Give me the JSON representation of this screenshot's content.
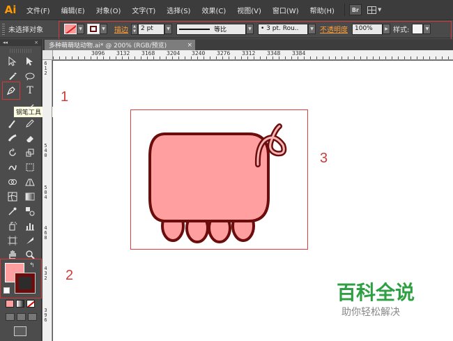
{
  "app": {
    "logo": "Ai"
  },
  "menu": [
    "文件(F)",
    "编辑(E)",
    "对象(O)",
    "文字(T)",
    "选择(S)",
    "效果(C)",
    "视图(V)",
    "窗口(W)",
    "帮助(H)"
  ],
  "menu_extra": {
    "bridge": "Br"
  },
  "control": {
    "selection_label": "未选择对象",
    "stroke_label": "描边",
    "stroke_weight": "2 pt",
    "profile_label": "等比",
    "brush": "• 3 pt. Rou..",
    "opacity_label": "不透明度",
    "opacity_value": "100%",
    "style_label": "样式:"
  },
  "document": {
    "tab_title": "多种萌萌哒动物.ai* @ 200% (RGB/预览)",
    "close": "×"
  },
  "ruler": {
    "top": [
      "3096",
      "3132",
      "3168",
      "3204",
      "3240",
      "3276",
      "3312",
      "3348",
      "3384"
    ],
    "left": [
      "612",
      "540",
      "504",
      "468",
      "432",
      "396"
    ]
  },
  "tools": {
    "text_tool": "T",
    "tooltip": "钢笔工具 (P)",
    "swap": "↰"
  },
  "colors": {
    "fill": "#ff9fa0",
    "stroke": "#6b0d0d",
    "highlight": "#d23a3a",
    "accent": "#ff9f3b"
  },
  "annotations": [
    "1",
    "2",
    "3"
  ],
  "watermark": {
    "title": "百科全说",
    "subtitle": "助你轻松解决"
  }
}
